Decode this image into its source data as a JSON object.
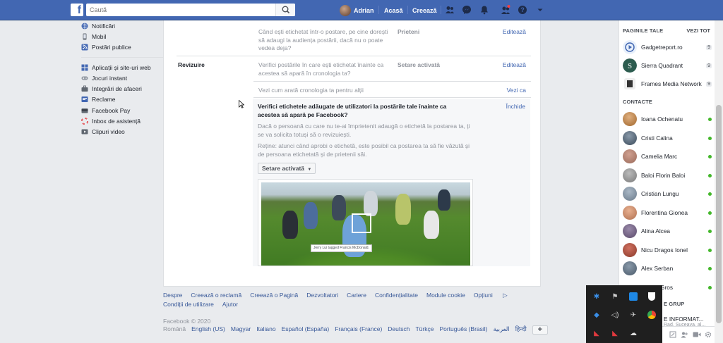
{
  "topbar": {
    "logo": "f",
    "search_placeholder": "Caută",
    "user_name": "Adrian",
    "home": "Acasă",
    "create": "Creează"
  },
  "leftnav": {
    "items_top": [
      {
        "label": "Notificări",
        "icon": "globe-icon"
      },
      {
        "label": "Mobil",
        "icon": "mobile-icon"
      },
      {
        "label": "Postări publice",
        "icon": "rss-icon"
      }
    ],
    "items_bottom": [
      {
        "label": "Aplicații și site-uri web",
        "icon": "apps-icon"
      },
      {
        "label": "Jocuri instant",
        "icon": "gamepad-icon"
      },
      {
        "label": "Integrări de afaceri",
        "icon": "business-icon"
      },
      {
        "label": "Reclame",
        "icon": "ads-icon"
      },
      {
        "label": "Facebook Pay",
        "icon": "pay-icon"
      },
      {
        "label": "Inbox de asistență",
        "icon": "lifebuoy-icon"
      },
      {
        "label": "Clipuri video",
        "icon": "video-icon"
      }
    ]
  },
  "settings": {
    "row1": {
      "desc": "Când ești etichetat într-o postare, pe cine dorești să adaugi la audiența postării, dacă nu o poate vedea deja?",
      "value": "Prieteni",
      "action": "Editează"
    },
    "section_review": "Revizuire",
    "row2": {
      "desc": "Verifici postările în care ești etichetat înainte ca acestea să apară în cronologia ta?",
      "value": "Setare activată",
      "action": "Editează"
    },
    "row3": {
      "desc": "Vezi cum arată cronologia ta pentru alții",
      "action": "Vezi ca"
    },
    "expanded": {
      "title": "Verifici etichetele adăugate de utilizatori la postările tale înainte ca acestea să apară pe Facebook?",
      "close": "Închide",
      "text1": "Dacă o persoană cu care nu te-ai împrietenit adaugă o etichetă la postarea ta, ți se va solicita totuși să o revizuiești.",
      "text2": "Reține: atunci când aprobi o etichetă, este posibil ca postarea ta să fie văzută și de persoana etichetată și de prietenii săi.",
      "dropdown": "Setare activată",
      "tag_label": "Jerry Lui tagged Francis McDonald."
    }
  },
  "footer": {
    "links": [
      "Despre",
      "Creează o reclamă",
      "Creează o Pagină",
      "Dezvoltatori",
      "Cariere",
      "Confidențialitate",
      "Module cookie",
      "Opțiuni",
      "Condiții de utilizare",
      "Ajutor"
    ],
    "copyright": "Facebook © 2020",
    "current_lang": "Română",
    "langs": [
      "English (US)",
      "Magyar",
      "Italiano",
      "Español (España)",
      "Français (France)",
      "Deutsch",
      "Türkçe",
      "Português (Brasil)",
      "العربية",
      "हिन्दी"
    ]
  },
  "rightbar": {
    "pages_header": "PAGINILE TALE",
    "see_all": "VEZI TOT",
    "pages": [
      {
        "name": "Gadgetreport.ro",
        "count": "9",
        "color": "#e8f0fb"
      },
      {
        "name": "Sierra Quadrant",
        "count": "9",
        "color": "#2d5c4f"
      },
      {
        "name": "Frames Media Network",
        "count": "9",
        "color": "#eeeeee"
      }
    ],
    "contacts_header": "CONTACTE",
    "contacts": [
      {
        "name": "Ioana Ochenatu",
        "color": "#a0662c"
      },
      {
        "name": "Cristi Calina",
        "color": "#3a4a5a"
      },
      {
        "name": "Camelia Marc",
        "color": "#9a6a5a"
      },
      {
        "name": "Baloi Florin Baloi",
        "color": "#7a7a7a"
      },
      {
        "name": "Cristian Lungu",
        "color": "#6a7a8a"
      },
      {
        "name": "Florentina Gionea",
        "color": "#b07050"
      },
      {
        "name": "Alina Alcea",
        "color": "#5a4a6a"
      },
      {
        "name": "Nicu Dragos Ionel",
        "color": "#8a3a2a"
      },
      {
        "name": "Alex Serban",
        "color": "#4a5a6a"
      },
      {
        "name": "Gros",
        "color": "#6a5a4a"
      }
    ],
    "group_header": "E GRUP",
    "group_line1": "E INFORMAT...",
    "group_line2": "Rad, Suceava, al..."
  },
  "colors": {
    "brand": "#4267b2",
    "link": "#385898",
    "online": "#42b72a"
  }
}
